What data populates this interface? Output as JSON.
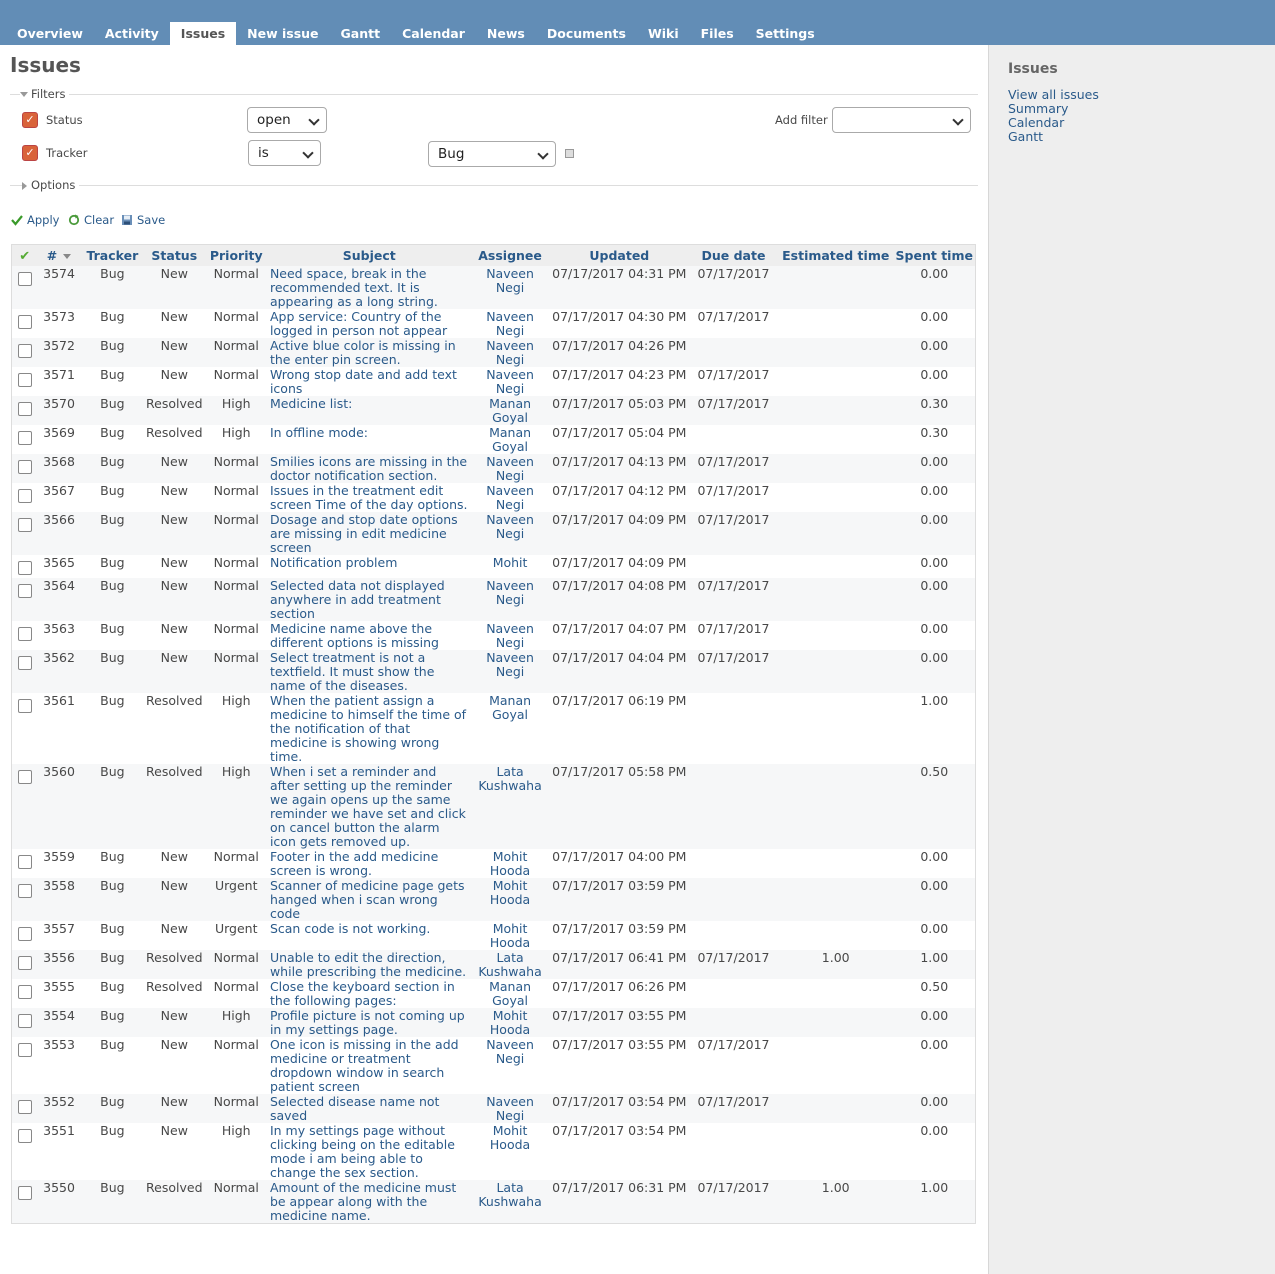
{
  "tabs": [
    "Overview",
    "Activity",
    "Issues",
    "New issue",
    "Gantt",
    "Calendar",
    "News",
    "Documents",
    "Wiki",
    "Files",
    "Settings"
  ],
  "selected_tab": "Issues",
  "page_title": "Issues",
  "filters": {
    "legend": "Filters",
    "status_label": "Status",
    "status_value": "open",
    "tracker_label": "Tracker",
    "tracker_operator": "is",
    "tracker_value": "Bug",
    "add_filter_label": "Add filter",
    "add_filter_value": ""
  },
  "options_legend": "Options",
  "actions": {
    "apply": "Apply",
    "clear": "Clear",
    "save": "Save"
  },
  "sidebar": {
    "title": "Issues",
    "links": [
      "View all issues",
      "Summary",
      "Calendar",
      "Gantt"
    ]
  },
  "table": {
    "headers": [
      "#",
      "Tracker",
      "Status",
      "Priority",
      "Subject",
      "Assignee",
      "Updated",
      "Due date",
      "Estimated time",
      "Spent time"
    ],
    "rows": [
      {
        "id": "3574",
        "tracker": "Bug",
        "status": "New",
        "priority": "Normal",
        "subject": "Need space, break in the recommended text. It is appearing as a long string.",
        "assignee": "Naveen Negi",
        "updated": "07/17/2017 04:31 PM",
        "due": "07/17/2017",
        "est": "",
        "spent": "0.00"
      },
      {
        "id": "3573",
        "tracker": "Bug",
        "status": "New",
        "priority": "Normal",
        "subject": "App service: Country of the logged in person not appear",
        "assignee": "Naveen Negi",
        "updated": "07/17/2017 04:30 PM",
        "due": "07/17/2017",
        "est": "",
        "spent": "0.00"
      },
      {
        "id": "3572",
        "tracker": "Bug",
        "status": "New",
        "priority": "Normal",
        "subject": "Active blue color is missing in the enter pin screen.",
        "assignee": "Naveen Negi",
        "updated": "07/17/2017 04:26 PM",
        "due": "",
        "est": "",
        "spent": "0.00"
      },
      {
        "id": "3571",
        "tracker": "Bug",
        "status": "New",
        "priority": "Normal",
        "subject": "Wrong stop date and add text icons",
        "assignee": "Naveen Negi",
        "updated": "07/17/2017 04:23 PM",
        "due": "07/17/2017",
        "est": "",
        "spent": "0.00"
      },
      {
        "id": "3570",
        "tracker": "Bug",
        "status": "Resolved",
        "priority": "High",
        "subject": "Medicine list:",
        "assignee": "Manan Goyal",
        "updated": "07/17/2017 05:03 PM",
        "due": "07/17/2017",
        "est": "",
        "spent": "0.30"
      },
      {
        "id": "3569",
        "tracker": "Bug",
        "status": "Resolved",
        "priority": "High",
        "subject": "In offline mode:",
        "assignee": "Manan Goyal",
        "updated": "07/17/2017 05:04 PM",
        "due": "",
        "est": "",
        "spent": "0.30"
      },
      {
        "id": "3568",
        "tracker": "Bug",
        "status": "New",
        "priority": "Normal",
        "subject": "Smilies icons are missing in the doctor notification section.",
        "assignee": "Naveen Negi",
        "updated": "07/17/2017 04:13 PM",
        "due": "07/17/2017",
        "est": "",
        "spent": "0.00"
      },
      {
        "id": "3567",
        "tracker": "Bug",
        "status": "New",
        "priority": "Normal",
        "subject": "Issues in the treatment edit screen Time of the day options.",
        "assignee": "Naveen Negi",
        "updated": "07/17/2017 04:12 PM",
        "due": "07/17/2017",
        "est": "",
        "spent": "0.00"
      },
      {
        "id": "3566",
        "tracker": "Bug",
        "status": "New",
        "priority": "Normal",
        "subject": "Dosage and stop date options are missing in edit medicine screen",
        "assignee": "Naveen Negi",
        "updated": "07/17/2017 04:09 PM",
        "due": "07/17/2017",
        "est": "",
        "spent": "0.00"
      },
      {
        "id": "3565",
        "tracker": "Bug",
        "status": "New",
        "priority": "Normal",
        "subject": "Notification problem",
        "assignee": "Mohit",
        "updated": "07/17/2017 04:09 PM",
        "due": "",
        "est": "",
        "spent": "0.00"
      },
      {
        "id": "3564",
        "tracker": "Bug",
        "status": "New",
        "priority": "Normal",
        "subject": "Selected data not displayed anywhere in add treatment section",
        "assignee": "Naveen Negi",
        "updated": "07/17/2017 04:08 PM",
        "due": "07/17/2017",
        "est": "",
        "spent": "0.00"
      },
      {
        "id": "3563",
        "tracker": "Bug",
        "status": "New",
        "priority": "Normal",
        "subject": "Medicine name above the different options is missing",
        "assignee": "Naveen Negi",
        "updated": "07/17/2017 04:07 PM",
        "due": "07/17/2017",
        "est": "",
        "spent": "0.00"
      },
      {
        "id": "3562",
        "tracker": "Bug",
        "status": "New",
        "priority": "Normal",
        "subject": "Select treatment is not a textfield. It must show the name of the diseases.",
        "assignee": "Naveen Negi",
        "updated": "07/17/2017 04:04 PM",
        "due": "07/17/2017",
        "est": "",
        "spent": "0.00"
      },
      {
        "id": "3561",
        "tracker": "Bug",
        "status": "Resolved",
        "priority": "High",
        "subject": "When the patient assign a medicine to himself the time of the notification of that medicine is showing wrong time.",
        "assignee": "Manan Goyal",
        "updated": "07/17/2017 06:19 PM",
        "due": "",
        "est": "",
        "spent": "1.00"
      },
      {
        "id": "3560",
        "tracker": "Bug",
        "status": "Resolved",
        "priority": "High",
        "subject": "When i set a reminder and after setting up the reminder we again opens up the same reminder we have set and click on cancel button the alarm icon gets removed up.",
        "assignee": "Lata Kushwaha",
        "updated": "07/17/2017 05:58 PM",
        "due": "",
        "est": "",
        "spent": "0.50"
      },
      {
        "id": "3559",
        "tracker": "Bug",
        "status": "New",
        "priority": "Normal",
        "subject": "Footer in the add medicine screen is wrong.",
        "assignee": "Mohit Hooda",
        "updated": "07/17/2017 04:00 PM",
        "due": "",
        "est": "",
        "spent": "0.00"
      },
      {
        "id": "3558",
        "tracker": "Bug",
        "status": "New",
        "priority": "Urgent",
        "subject": "Scanner of medicine page gets hanged when i scan wrong code",
        "assignee": "Mohit Hooda",
        "updated": "07/17/2017 03:59 PM",
        "due": "",
        "est": "",
        "spent": "0.00"
      },
      {
        "id": "3557",
        "tracker": "Bug",
        "status": "New",
        "priority": "Urgent",
        "subject": "Scan code is not working.",
        "assignee": "Mohit Hooda",
        "updated": "07/17/2017 03:59 PM",
        "due": "",
        "est": "",
        "spent": "0.00"
      },
      {
        "id": "3556",
        "tracker": "Bug",
        "status": "Resolved",
        "priority": "Normal",
        "subject": "Unable to edit the direction, while prescribing the medicine.",
        "assignee": "Lata Kushwaha",
        "updated": "07/17/2017 06:41 PM",
        "due": "07/17/2017",
        "est": "1.00",
        "spent": "1.00"
      },
      {
        "id": "3555",
        "tracker": "Bug",
        "status": "Resolved",
        "priority": "Normal",
        "subject": "Close the keyboard section in the following pages:",
        "assignee": "Manan Goyal",
        "updated": "07/17/2017 06:26 PM",
        "due": "",
        "est": "",
        "spent": "0.50"
      },
      {
        "id": "3554",
        "tracker": "Bug",
        "status": "New",
        "priority": "High",
        "subject": "Profile picture is not coming up in my settings page.",
        "assignee": "Mohit Hooda",
        "updated": "07/17/2017 03:55 PM",
        "due": "",
        "est": "",
        "spent": "0.00"
      },
      {
        "id": "3553",
        "tracker": "Bug",
        "status": "New",
        "priority": "Normal",
        "subject": "One icon is missing in the add medicine or treatment dropdown window in search patient screen",
        "assignee": "Naveen Negi",
        "updated": "07/17/2017 03:55 PM",
        "due": "07/17/2017",
        "est": "",
        "spent": "0.00"
      },
      {
        "id": "3552",
        "tracker": "Bug",
        "status": "New",
        "priority": "Normal",
        "subject": "Selected disease name not saved",
        "assignee": "Naveen Negi",
        "updated": "07/17/2017 03:54 PM",
        "due": "07/17/2017",
        "est": "",
        "spent": "0.00"
      },
      {
        "id": "3551",
        "tracker": "Bug",
        "status": "New",
        "priority": "High",
        "subject": "In my settings page without clicking being on the editable mode i am being able to change the sex section.",
        "assignee": "Mohit Hooda",
        "updated": "07/17/2017 03:54 PM",
        "due": "",
        "est": "",
        "spent": "0.00"
      },
      {
        "id": "3550",
        "tracker": "Bug",
        "status": "Resolved",
        "priority": "Normal",
        "subject": "Amount of the medicine must be appear along with the medicine name.",
        "assignee": "Lata Kushwaha",
        "updated": "07/17/2017 06:31 PM",
        "due": "07/17/2017",
        "est": "1.00",
        "spent": "1.00"
      }
    ]
  }
}
